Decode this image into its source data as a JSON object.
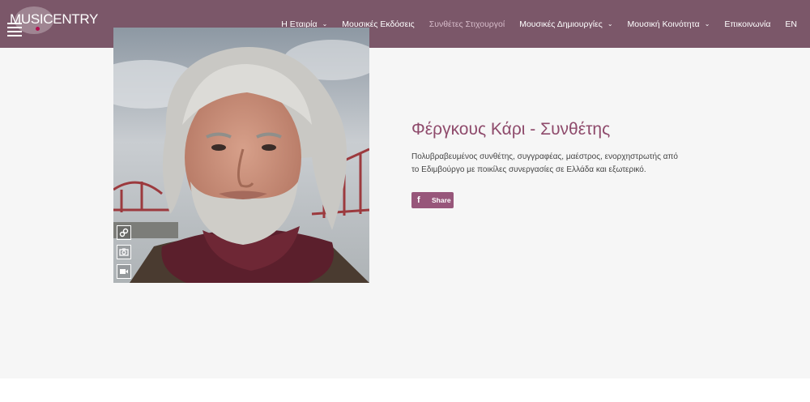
{
  "brand": {
    "logo_text": "MUSICENTRY"
  },
  "nav": {
    "items": [
      {
        "label": "Η Εταιρία",
        "has_dropdown": true,
        "active": false
      },
      {
        "label": "Μουσικές Εκδόσεις",
        "has_dropdown": false,
        "active": false
      },
      {
        "label": "Συνθέτες Στιχουργοί",
        "has_dropdown": false,
        "active": true
      },
      {
        "label": "Μουσικές Δημιουργίες",
        "has_dropdown": true,
        "active": false
      },
      {
        "label": "Μουσική Κοινότητα",
        "has_dropdown": true,
        "active": false
      },
      {
        "label": "Επικοινωνία",
        "has_dropdown": false,
        "active": false
      },
      {
        "label": "EN",
        "has_dropdown": false,
        "active": false
      }
    ]
  },
  "profile": {
    "title": "Φέργκους Κάρι - Συνθέτης",
    "description": "Πολυβραβευμένος συνθέτης, συγγραφέας, μαέστρος, ενορχηστρωτής από το Εδιμβούργο με ποικίλες συνεργασίες σε Ελλάδα και εξωτερικό.",
    "photo_icons": [
      "link-icon",
      "camera-icon",
      "video-icon"
    ]
  },
  "share": {
    "label": "Share",
    "icon": "facebook-icon"
  },
  "colors": {
    "header_bg": "#7b5769",
    "title": "#8e4a6b",
    "share_bg": "#97567a",
    "nav_active": "#d7bcca",
    "content_bg": "#f6f6f6"
  }
}
